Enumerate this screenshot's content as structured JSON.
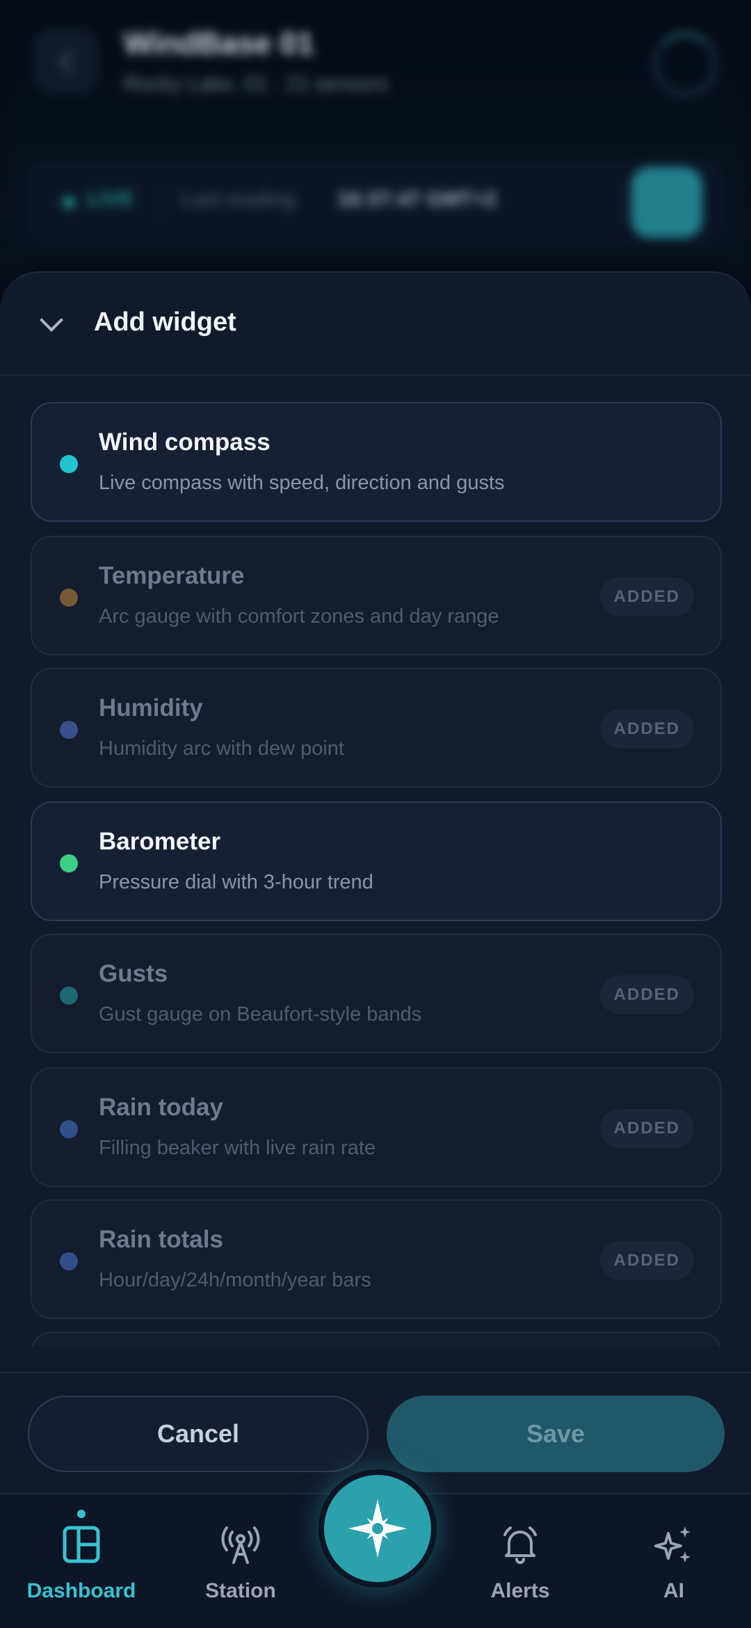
{
  "background": {
    "title": "WindBase 01",
    "subtitle": "Rocky Lake, 01 · 21 sensors",
    "live_label": "LIVE",
    "last_reading_label": "Last reading",
    "last_reading_value": "16:37:47 GMT+2"
  },
  "sheet": {
    "title": "Add widget",
    "widgets": [
      {
        "name": "Wind compass",
        "description": "Live compass with speed, direction and gusts",
        "status": "available",
        "dot_color": "#22c4d2"
      },
      {
        "name": "Temperature",
        "description": "Arc gauge with comfort zones and day range",
        "status": "added",
        "badge": "ADDED",
        "dot_color": "#c98a3e"
      },
      {
        "name": "Humidity",
        "description": "Humidity arc with dew point",
        "status": "added",
        "badge": "ADDED",
        "dot_color": "#5a7bd8"
      },
      {
        "name": "Barometer",
        "description": "Pressure dial with 3-hour trend",
        "status": "available",
        "dot_color": "#3ecf85"
      },
      {
        "name": "Gusts",
        "description": "Gust gauge on Beaufort-style bands",
        "status": "added",
        "badge": "ADDED",
        "dot_color": "#2aa6ad"
      },
      {
        "name": "Rain today",
        "description": "Filling beaker with live rain rate",
        "status": "added",
        "badge": "ADDED",
        "dot_color": "#4a78d6"
      },
      {
        "name": "Rain totals",
        "description": "Hour/day/24h/month/year bars",
        "status": "added",
        "badge": "ADDED",
        "dot_color": "#4a78d6"
      }
    ],
    "cancel_label": "Cancel",
    "save_label": "Save"
  },
  "nav": {
    "items": [
      {
        "label": "Dashboard",
        "icon": "dashboard-icon",
        "active": true
      },
      {
        "label": "Station",
        "icon": "antenna-icon",
        "active": false
      },
      {
        "label": "Alerts",
        "icon": "bell-icon",
        "active": false
      },
      {
        "label": "AI",
        "icon": "sparkles-icon",
        "active": false
      }
    ],
    "fab_icon": "compass-icon"
  },
  "colors": {
    "accent": "#38c2d1",
    "sheet_bg": "#111a2b",
    "save_button": "#1f5868"
  }
}
